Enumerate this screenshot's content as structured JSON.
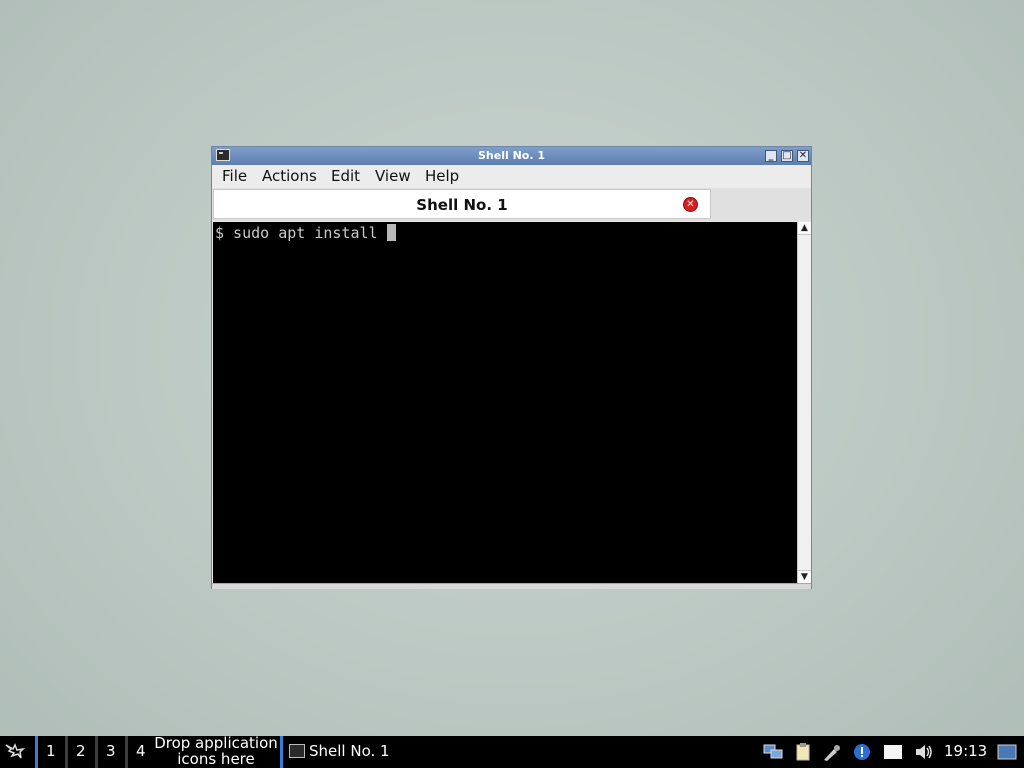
{
  "window": {
    "title": "Shell No. 1",
    "menu": [
      "File",
      "Actions",
      "Edit",
      "View",
      "Help"
    ],
    "tab_label": "Shell No. 1",
    "terminal_line": "$ sudo apt install "
  },
  "taskbar": {
    "workspaces": [
      "1",
      "2",
      "3",
      "4"
    ],
    "drop_hint_line1": "Drop application",
    "drop_hint_line2": "icons here",
    "task_label": "Shell No. 1",
    "clock": "19:13"
  },
  "icons": {
    "menu_logo": "lxde-menu-icon",
    "tray": [
      "network-icon",
      "clipboard-icon",
      "paint-icon",
      "update-notification-icon",
      "display-icon",
      "volume-icon",
      "desktop-icon"
    ]
  },
  "colors": {
    "titlebar": "#6a8cbd",
    "active_workspace": "#3a7bd5",
    "terminal_bg": "#000000"
  }
}
